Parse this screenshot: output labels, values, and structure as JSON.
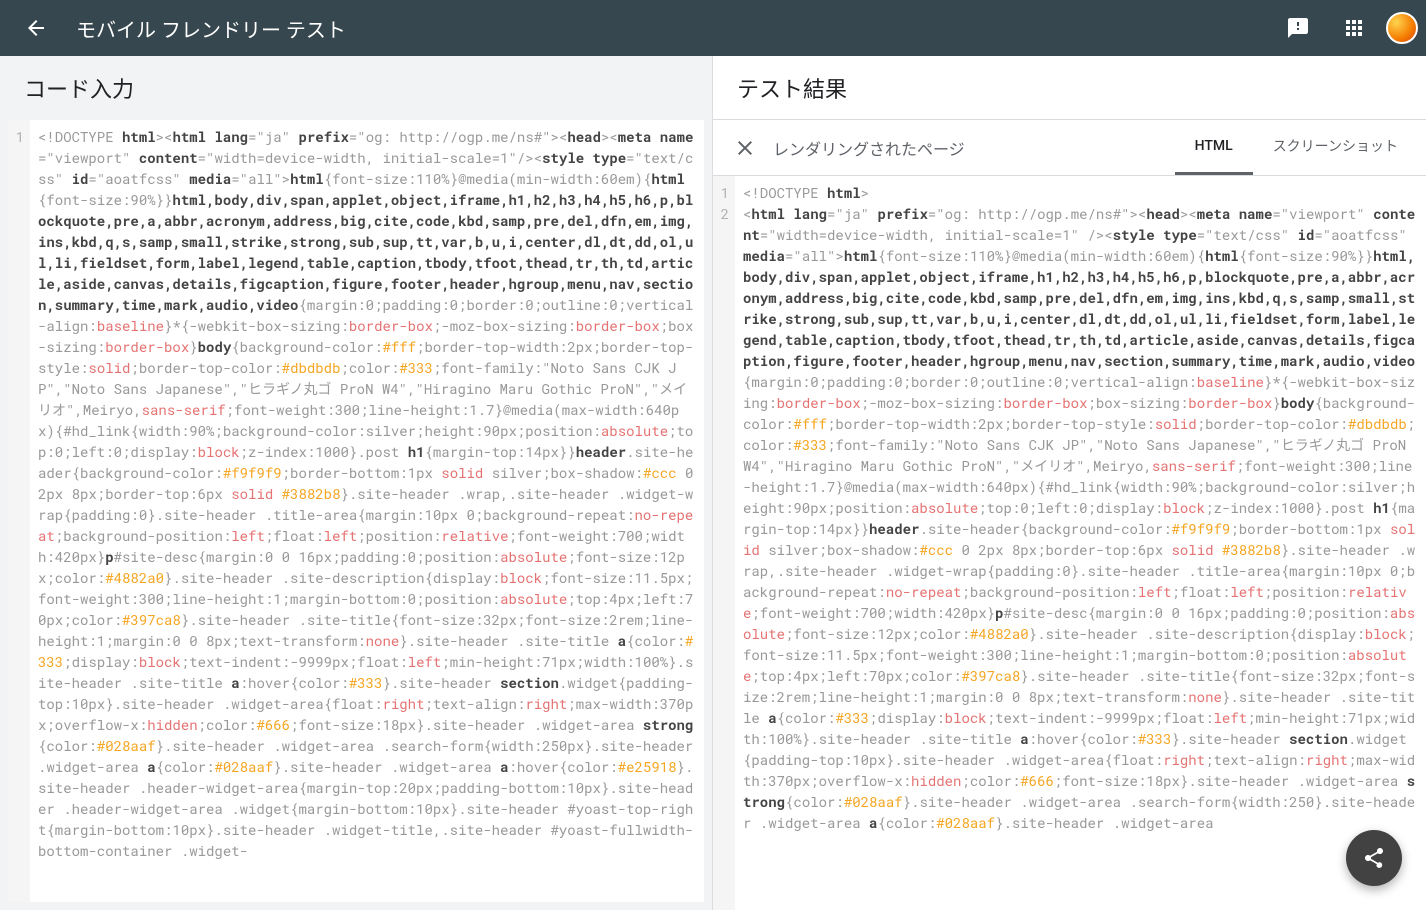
{
  "header": {
    "title": "モバイル フレンドリー テスト"
  },
  "left": {
    "title": "コード入力",
    "gutter": "1"
  },
  "right": {
    "title": "テスト結果",
    "rendered_label": "レンダリングされたページ",
    "tabs": {
      "html": "HTML",
      "screenshot": "スクリーンショット"
    },
    "gutter1": "1",
    "gutter2": "2"
  },
  "code": {
    "doctype_l": "<!DOCTYPE ",
    "doctype_html": "html",
    "doctype_r": ">",
    "html_open_l": "<",
    "html_tag": "html lang",
    "html_eq": "=",
    "html_ja": "\"ja\" ",
    "prefix": "prefix",
    "prefix_val": "=\"og: http://ogp.me/ns#\">",
    "head_l": "<",
    "head_t": "head",
    "head_r": ">",
    "meta_l": "<",
    "meta_name": "meta name",
    "meta_viewport": "=\"viewport\" ",
    "content": "content",
    "content_val": "=\"width=device-width, initial-scale=1\"",
    "meta_close": "/>",
    "meta_close_sp": " />",
    "style_l": "<",
    "style_type": "style type",
    "style_val": "=\"text/css\" ",
    "id": "id",
    "id_val": "=\"aoatfcss\" ",
    "media": "media",
    "media_val": "=\"all\">",
    "html_sel": "html",
    "fs110": "{font-size:110%}@media(min-width:60em){",
    "html_sel2": "html",
    "fseq": "{font-size:90%}}",
    "taglist": "html,body,div,span,applet,object,iframe,h1,h2,h3,h4,h5,h6,p,blockquote,pre,a,abbr,acronym,address,big,cite,code,kbd,samp,pre,del,dfn,em,img,ins,kbd,q,s,samp,small,strike,strong,sub,sup,tt,var,b,u,i,center,dl,dt,dd,ol,ul,li,fieldset,form,label,legend,table,caption,tbody,tfoot,thead,tr,th,td,article,aside,canvas,details,figcaption,figure,footer,header,hgroup,menu,nav,section,summary,time,mark,audio,video",
    "reset": "{margin:0;padding:0;border:0;outline:0;vertical-align:",
    "baseline": "baseline",
    "star": "}*{-webkit-box-sizing:",
    "borderbox1": "border-box",
    "moz": ";-moz-box-sizing:",
    "borderbox2": "border-box",
    "bs": ";box-sizing:",
    "borderbox3": "border-box",
    "body_l": "}",
    "body_t": "body",
    "bgc": "{background-color:",
    "fff": "#fff",
    "btw": ";border-top-width:2px;border-top-style:",
    "solid1": "solid",
    "btc": ";border-top-color:",
    "dbdbdb": "#dbdbdb",
    "col": ";color:",
    "c333": "#333",
    "ff": ";font-family:\"Noto Sans CJK JP\",\"Noto Sans Japanese\",\"ヒラギノ丸ゴ ProN W4\",\"Hiragino Maru Gothic ProN\",\"メイリオ\",Meiryo,",
    "sans": "sans-serif",
    "fw300": ";font-weight:300;line-height:1.7}@media(max-width:640px){#hd_link{width:90%;background-color:silver;height:90px;position:",
    "absolute1": "absolute",
    "topleft": ";top:0;left:0;display:",
    "block1": "block",
    "zidx": ";z-index:1000}.post ",
    "h1": "h1",
    "mt14": "{margin-top:14px}}",
    "header_t": "header",
    "sh": ".site-header{background-color:",
    "f9": "#f9f9f9",
    "bb1": ";border-bottom:1px ",
    "solid2": "solid",
    "silver": " silver;box-shadow:",
    "ccc": "#ccc",
    "px028": " 0 2px 8px;border-top:6px ",
    "solid3": "solid",
    "sp": " ",
    "c3882": "#3882b8",
    "wrap": "}.site-header .wrap,.site-header .widget-wrap{padding:0}.site-header .title-area{margin:10px 0;background-repeat:",
    "norepeat": "no-repeat",
    "bgpos": ";background-position:",
    "left1": "left",
    "flt": ";float:",
    "left2": "left",
    "pos": ";position:",
    "relative": "relative",
    "fw700": ";font-weight:700;width:420px}",
    "p_t": "p",
    "sdesc": "#site-desc{margin:0 0 16px;padding:0;position:",
    "absolute2": "absolute",
    "fs12": ";font-size:12px;color:",
    "c4882": "#4882a0",
    "sd2": "}.site-header .site-description{display:",
    "block2": "block",
    "fs115": ";font-size:11.5px;font-weight:300;line-height:1;margin-bottom:0;position:",
    "absolute3": "absolute",
    "top4": ";top:4px;left:70px;color:",
    "c397": "#397ca8",
    "stitle": "}.site-header .site-title{font-size:32px;font-size:2rem;line-height:1;margin:0 0 8px;text-transform:",
    "none1": "none",
    "sta": "}.site-header .site-title ",
    "a_t": "a",
    "col2": "{color:",
    "c333b": "#333",
    "dsp": ";display:",
    "block3": "block",
    "ti": ";text-indent:-9999px;float:",
    "left3": "left",
    "mh": ";min-height:71px;width:100%}.site-header .site-title ",
    "a_t2": "a",
    "hov": ":hover{color:",
    "c333c": "#333",
    "shsec": "}.site-header ",
    "section_t": "section",
    "wdg": ".widget{padding-top:10px}.site-header .widget-area{float:",
    "right1": "right",
    "ta": ";text-align:",
    "right2": "right",
    "mw": ";max-width:370px;overflow-x:",
    "hidden": "hidden",
    "col3": ";color:",
    "c666": "#666",
    "fs18": ";font-size:18px}.site-header .widget-area ",
    "strong_t": "strong",
    "col4": "{color:",
    "c028a": "#028aaf",
    "sf": "}.site-header .widget-area .search-form{width:250px}.site-header .widget-area ",
    "a_t3": "a",
    "col5": "{color:",
    "c028b": "#028aaf",
    "shwa": "}.site-header .widget-area ",
    "a_t4": "a",
    "hov2": ":hover{color:",
    "ce25": "#e25918",
    "hwa": "}.site-header .header-widget-area{margin-top:20px;padding-bottom:10px}.site-header .header-widget-area .widget{margin-bottom:10px}.site-header #yoast-top-right{margin-bottom:10px}.site-header .widget-title,.site-header #yoast-fullwidth-bottom-container .widget-",
    "sf2": "}.site-header .widget-area .search-form{width:250}.site-header .widget-area ",
    "hwa_r": "}.site-header .widget-area"
  }
}
